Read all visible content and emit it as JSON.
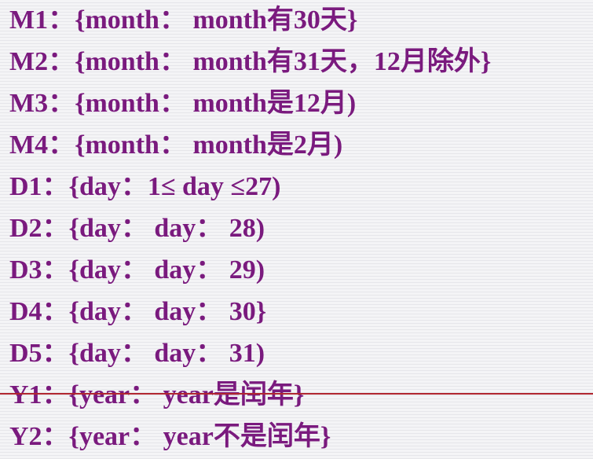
{
  "lines": [
    "M1：{month： month有30天}",
    "M2：{month： month有31天，12月除外}",
    "M3：{month： month是12月)",
    "M4：{month： month是2月)",
    "D1：{day：1≤ day ≤27)",
    "D2：{day： day： 28)",
    "D3：{day： day： 29)",
    "D4：{day： day： 30}",
    "D5：{day： day： 31)",
    "Y1：{year： year是闰年}",
    "Y2：{year： year不是闰年}"
  ],
  "colors": {
    "text": "#7a1a7e",
    "rule": "#b0262f"
  }
}
